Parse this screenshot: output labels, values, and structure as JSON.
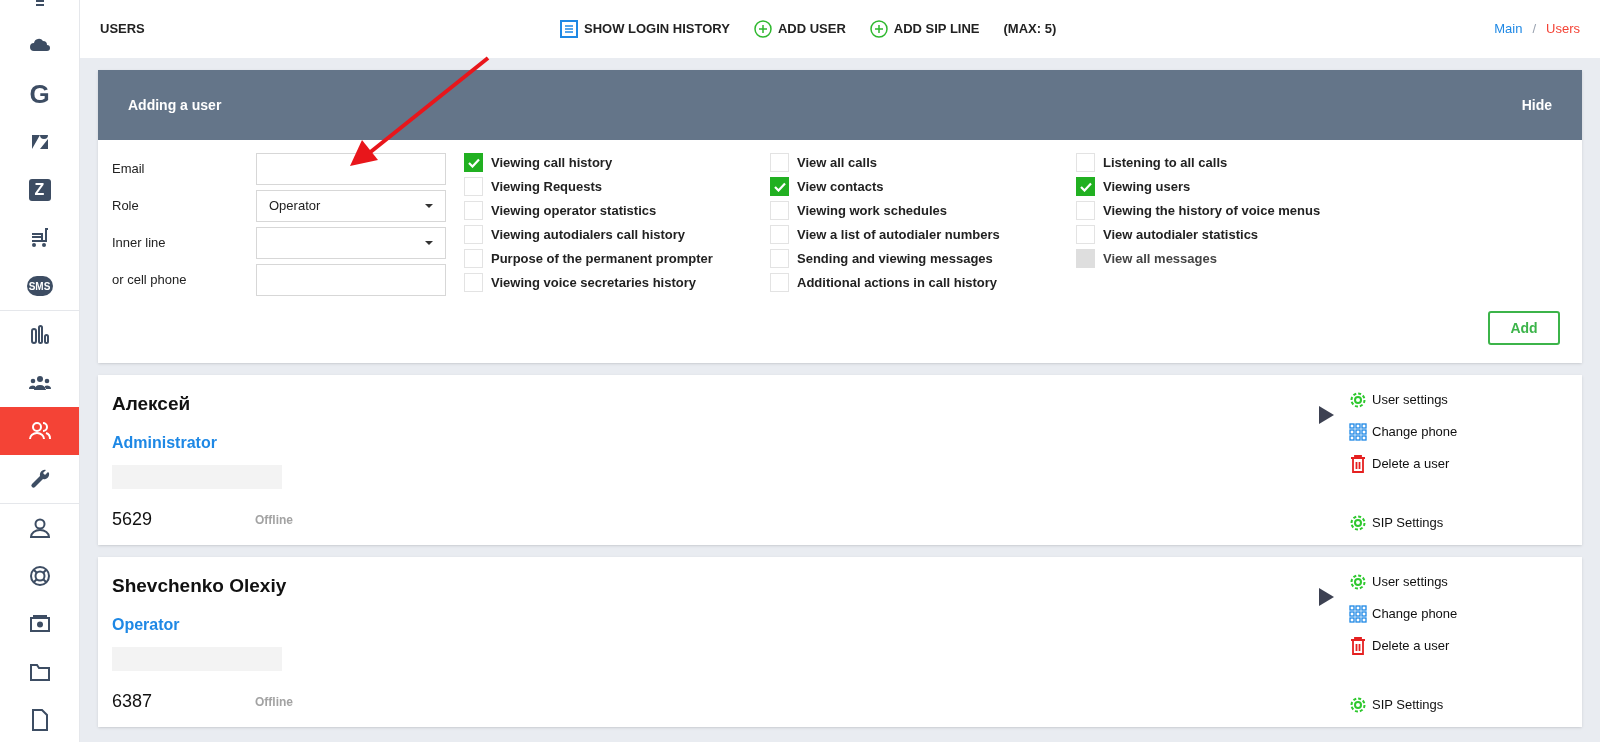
{
  "sidebar": {
    "groups": [
      [
        {
          "kind": "menu",
          "selected": false
        },
        {
          "kind": "cloud",
          "selected": false
        },
        {
          "kind": "letter",
          "glyph": "G",
          "selected": false
        },
        {
          "kind": "zendesk",
          "selected": false
        },
        {
          "kind": "square-letter",
          "glyph": "Z",
          "selected": false
        },
        {
          "kind": "cart",
          "selected": false
        },
        {
          "kind": "bubble",
          "glyph": "SMS",
          "selected": false
        }
      ],
      [
        {
          "kind": "bars",
          "selected": false
        },
        {
          "kind": "team",
          "selected": false
        },
        {
          "kind": "users",
          "selected": true
        },
        {
          "kind": "wrench",
          "selected": false
        }
      ],
      [
        {
          "kind": "person",
          "selected": false
        },
        {
          "kind": "lifebuoy",
          "selected": false
        },
        {
          "kind": "money",
          "selected": false
        },
        {
          "kind": "folder",
          "selected": false
        },
        {
          "kind": "doc",
          "selected": false
        }
      ]
    ]
  },
  "header": {
    "title": "USERS",
    "actions": [
      {
        "kind": "list",
        "label": "SHOW LOGIN HISTORY"
      },
      {
        "kind": "plus",
        "label": "ADD USER"
      },
      {
        "kind": "plus",
        "label": "ADD SIP LINE"
      }
    ],
    "note": "(MAX: 5)",
    "breadcrumbs": [
      {
        "label": "Main",
        "selected": false
      },
      {
        "label": "Users",
        "selected": true
      }
    ],
    "separator": "/"
  },
  "add_user": {
    "title": "Adding a user",
    "hide": "Hide",
    "fields": [
      {
        "label": "Email",
        "kind": "text"
      },
      {
        "label": "Role",
        "kind": "select",
        "value": "Operator"
      },
      {
        "label": "Inner line",
        "kind": "select"
      },
      {
        "label": "or cell phone",
        "kind": "text"
      }
    ],
    "permissions": [
      [
        {
          "label": "Viewing call history",
          "checked": true,
          "disabled": false
        },
        {
          "label": "Viewing Requests",
          "checked": false,
          "disabled": false
        },
        {
          "label": "Viewing operator statistics",
          "checked": false,
          "disabled": false
        },
        {
          "label": "Viewing autodialers call history",
          "checked": false,
          "disabled": false
        },
        {
          "label": "Purpose of the permanent prompter",
          "checked": false,
          "disabled": false
        },
        {
          "label": "Viewing voice secretaries history",
          "checked": false,
          "disabled": false
        }
      ],
      [
        {
          "label": "View all calls",
          "checked": false,
          "disabled": false
        },
        {
          "label": "View contacts",
          "checked": true,
          "disabled": false
        },
        {
          "label": "Viewing work schedules",
          "checked": false,
          "disabled": false
        },
        {
          "label": "View a list of autodialer numbers",
          "checked": false,
          "disabled": false
        },
        {
          "label": "Sending and viewing messages",
          "checked": false,
          "disabled": false
        },
        {
          "label": "Additional actions in call history",
          "checked": false,
          "disabled": false
        }
      ],
      [
        {
          "label": "Listening to all calls",
          "checked": false,
          "disabled": false
        },
        {
          "label": "Viewing users",
          "checked": true,
          "disabled": false
        },
        {
          "label": "Viewing the history of voice menus",
          "checked": false,
          "disabled": false
        },
        {
          "label": "View autodialer statistics",
          "checked": false,
          "disabled": false
        },
        {
          "label": "View all messages",
          "checked": false,
          "disabled": true
        }
      ]
    ],
    "add_button": "Add"
  },
  "users": [
    {
      "name": "Алексей",
      "role": "Administrator",
      "line": "5629",
      "status": "Offline",
      "actions": [
        {
          "kind": "gear",
          "label": "User settings"
        },
        {
          "kind": "grid",
          "label": "Change phone"
        },
        {
          "kind": "trash",
          "label": "Delete a user"
        }
      ],
      "sip": "SIP Settings"
    },
    {
      "name": "Shevchenko Olexiy",
      "role": "Operator",
      "line": "6387",
      "status": "Offline",
      "actions": [
        {
          "kind": "gear",
          "label": "User settings"
        },
        {
          "kind": "grid",
          "label": "Change phone"
        },
        {
          "kind": "trash",
          "label": "Delete a user"
        }
      ],
      "sip": "SIP Settings"
    }
  ]
}
